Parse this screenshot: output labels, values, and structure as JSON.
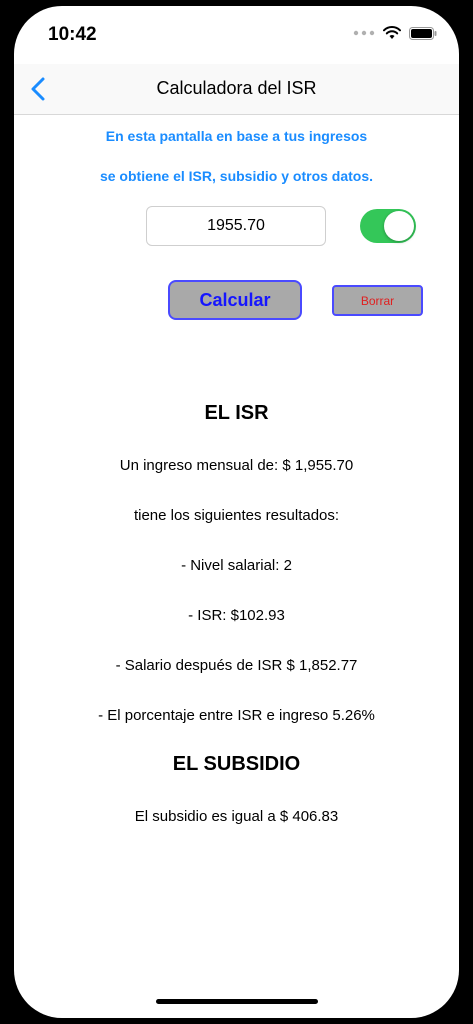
{
  "status_bar": {
    "time": "10:42",
    "icons": [
      "dots-icon",
      "wifi-icon",
      "battery-icon"
    ]
  },
  "nav": {
    "back_icon": "chevron-left-icon",
    "title": "Calculadora del ISR"
  },
  "intro": {
    "line1": "En esta pantalla en base a tus ingresos",
    "line2": "se obtiene el ISR, subsidio y otros datos."
  },
  "form": {
    "amount_value": "1955.70",
    "toggle_on": true,
    "calc_label": "Calcular",
    "clear_label": "Borrar"
  },
  "results": {
    "isr_heading": "EL ISR",
    "income_line": "Un ingreso mensual de: $ 1,955.70",
    "intro_line": "tiene los siguientes resultados:",
    "level_line": "- Nivel salarial: 2",
    "isr_line": "- ISR: $102.93",
    "salary_line": "- Salario después de ISR $ 1,852.77",
    "percent_line": "- El porcentaje entre ISR e ingreso 5.26%",
    "subsidy_heading": "EL SUBSIDIO",
    "subsidy_line": "El subsidio es igual a $ 406.83"
  },
  "colors": {
    "accent_blue": "#1a8cff",
    "toggle_green": "#34c759",
    "button_gray": "#a9a9a9",
    "button_border": "#4a4aff",
    "calc_text": "#1515ff",
    "clear_text": "#e02020"
  }
}
